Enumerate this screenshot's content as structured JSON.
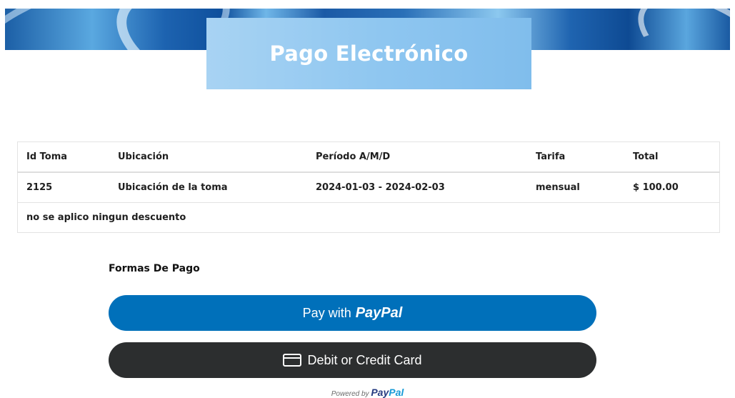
{
  "header": {
    "title": "Pago Electrónico"
  },
  "table": {
    "columns": [
      "Id Toma",
      "Ubicación",
      "Período A/M/D",
      "Tarifa",
      "Total"
    ],
    "row": {
      "id_toma": "2125",
      "ubicacion": "Ubicación de la toma",
      "periodo": "2024-01-03 - 2024-02-03",
      "tarifa": "mensual",
      "total": "$ 100.00"
    },
    "note": "no se aplico ningun descuento"
  },
  "payment": {
    "section_title": "Formas De Pago",
    "paypal_button": {
      "prefix": "Pay with",
      "brand": "PayPal"
    },
    "card_button": {
      "label": "Debit or Credit Card"
    },
    "powered_by": {
      "prefix": "Powered by",
      "brand_pay": "Pay",
      "brand_pal": "Pal"
    }
  },
  "colors": {
    "paypal_blue": "#0070ba",
    "card_dark": "#2c2e2f",
    "title_box": "#8ec6f0"
  }
}
